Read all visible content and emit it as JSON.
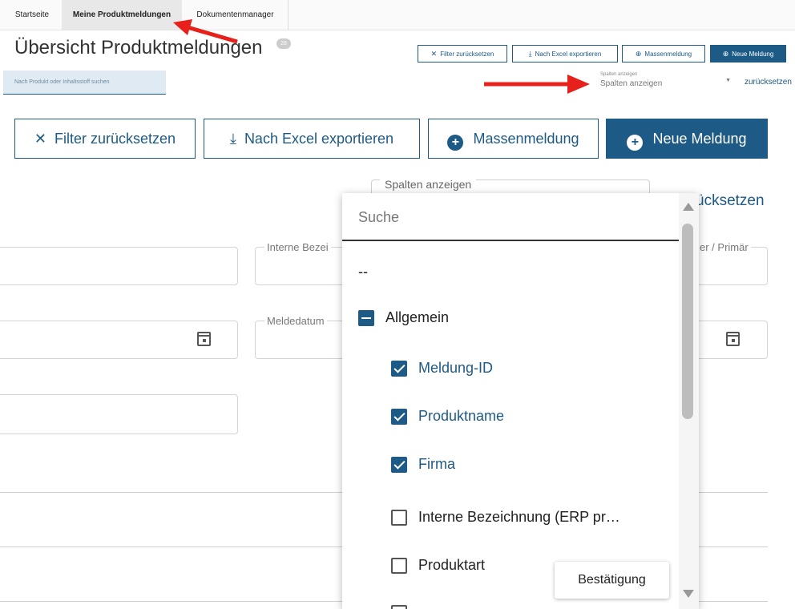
{
  "tabs": [
    {
      "label": "Startseite"
    },
    {
      "label": "Meine Produktmeldungen"
    },
    {
      "label": "Dokumentenmanager"
    }
  ],
  "header": {
    "title": "Übersicht Produktmeldungen",
    "count": "28"
  },
  "toolbar": {
    "reset_filter": "Filter zurücksetzen",
    "export_excel": "Nach Excel exportieren",
    "mass_report": "Massenmeldung",
    "new_report": "Neue Meldung"
  },
  "search": {
    "placeholder": "Nach Produkt oder Inhaltsstoff suchen"
  },
  "columns_select": {
    "label": "Spalten anzeigen",
    "value": "Spalten anzeigen",
    "reset": "zurücksetzen",
    "reset_partial": "ücksetzen"
  },
  "filters": {
    "internal_label": "Interne Bezei",
    "report_date_label": "Meldedatum",
    "right_label": "er / Primär"
  },
  "dropdown": {
    "search_placeholder": "Suche",
    "none_option": "--",
    "group_label": "Allgemein",
    "items": [
      {
        "label": "Meldung-ID",
        "checked": true
      },
      {
        "label": "Produktname",
        "checked": true
      },
      {
        "label": "Firma",
        "checked": true
      },
      {
        "label": "Interne Bezeichnung (ERP pr…",
        "checked": false
      },
      {
        "label": "Produktart",
        "checked": false
      }
    ],
    "confirm": "Bestätigung"
  },
  "colors": {
    "primary": "#1d5a86",
    "annotation_arrow": "#e8201c"
  }
}
